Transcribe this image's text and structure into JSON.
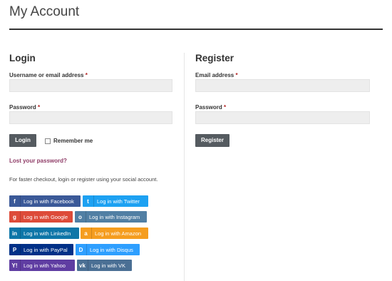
{
  "page": {
    "title": "My Account"
  },
  "login": {
    "heading": "Login",
    "username_label": "Username or email address",
    "password_label": "Password",
    "required_mark": "*",
    "login_button": "Login",
    "remember_label": "Remember me",
    "lost_password": "Lost your password?",
    "social_note": "For faster checkout, login or register using your social account."
  },
  "register": {
    "heading": "Register",
    "email_label": "Email address",
    "password_label": "Password",
    "required_mark": "*",
    "register_button": "Register"
  },
  "social_buttons": [
    {
      "label": "Log in with Facebook",
      "icon": "f",
      "color": "#3b5998"
    },
    {
      "label": "Log in with Twitter",
      "icon": "t",
      "color": "#1da1f2"
    },
    {
      "label": "Log in with Google",
      "icon": "g",
      "color": "#dd4b39"
    },
    {
      "label": "Log in with Instagram",
      "icon": "o",
      "color": "#517fa4"
    },
    {
      "label": "Log in with LinkedIn",
      "icon": "in",
      "color": "#0e76a8"
    },
    {
      "label": "Log in with Amazon",
      "icon": "a",
      "color": "#f59d1f"
    },
    {
      "label": "Log in with PayPal",
      "icon": "P",
      "color": "#003087"
    },
    {
      "label": "Log in with Disqus",
      "icon": "D",
      "color": "#2e9fff"
    },
    {
      "label": "Log in with Yahoo",
      "icon": "Y!",
      "color": "#5f3da2"
    },
    {
      "label": "Log in with VK",
      "icon": "vk",
      "color": "#4a6f94"
    }
  ]
}
